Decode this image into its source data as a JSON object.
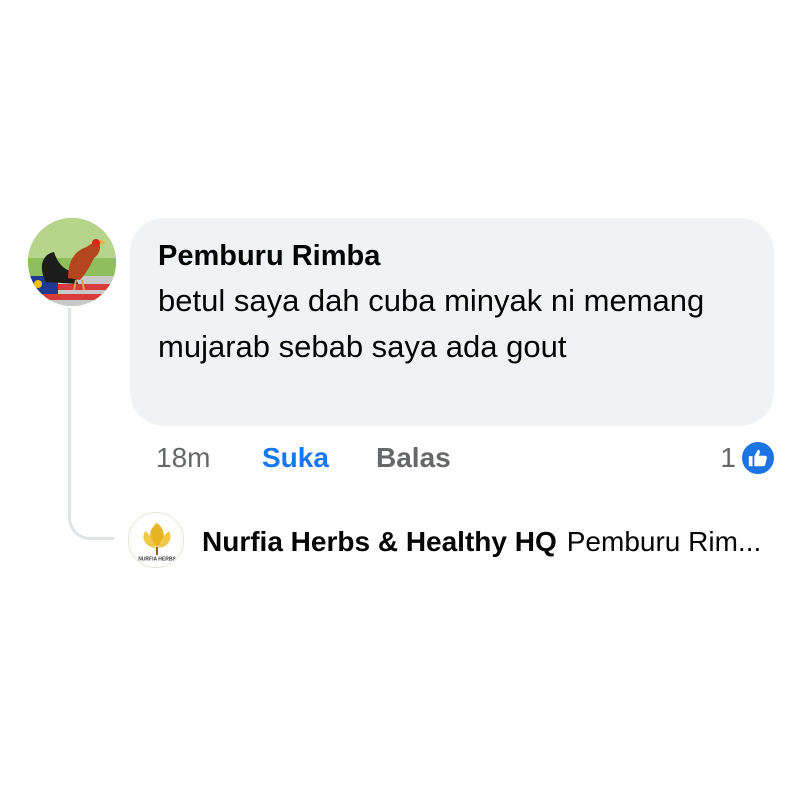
{
  "comment": {
    "author": "Pemburu Rimba",
    "text": "betul saya dah cuba minyak ni memang mujarab sebab saya ada gout",
    "time": "18m",
    "like_label": "Suka",
    "reply_label": "Balas",
    "reaction_count": "1",
    "reaction_icon": "like-icon",
    "avatar_icon": "rooster-avatar"
  },
  "reply": {
    "author": "Nurfia Herbs & Healthy HQ",
    "preview": "Pemburu Rim...",
    "avatar_icon": "nurfia-herbs-logo",
    "logo_text": "NURFIA HERBS"
  },
  "colors": {
    "bubble": "#f0f2f5",
    "accent": "#1877f2",
    "muted": "#65676b"
  }
}
